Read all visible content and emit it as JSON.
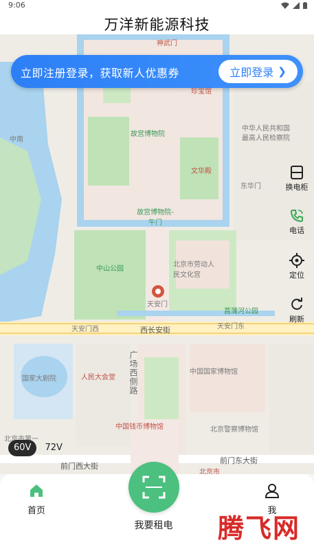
{
  "status_bar": {
    "time": "9:06"
  },
  "header": {
    "title": "万洋新能源科技"
  },
  "promo": {
    "text": "立即注册登录，获取新人优惠券",
    "button_label": "立即登录",
    "chevron": "❯",
    "color": "#2d7ff6"
  },
  "map": {
    "labels": [
      {
        "text": "神武门",
        "kind": "red"
      },
      {
        "text": "珍宝馆",
        "kind": "red"
      },
      {
        "text": "故宫博物院",
        "kind": "green"
      },
      {
        "text": "文华殿",
        "kind": "red"
      },
      {
        "text": "中华人民共和国",
        "kind": "plain"
      },
      {
        "text": "最高人民检察院",
        "kind": "plain"
      },
      {
        "text": "中南",
        "kind": "plain"
      },
      {
        "text": "东华门",
        "kind": "plain"
      },
      {
        "text": "故宫博物院-午门",
        "kind": "green"
      },
      {
        "text": "中山公园",
        "kind": "green"
      },
      {
        "text": "北京市劳动人民文化宫",
        "kind": "plain"
      },
      {
        "text": "天安门",
        "kind": "plain"
      },
      {
        "text": "菖蒲河公园",
        "kind": "green"
      },
      {
        "text": "天安门西",
        "kind": "plain"
      },
      {
        "text": "西长安街",
        "kind": "plain"
      },
      {
        "text": "天安门东",
        "kind": "plain"
      },
      {
        "text": "国家大剧院",
        "kind": "plain"
      },
      {
        "text": "人民大会堂",
        "kind": "red"
      },
      {
        "text": "广场西侧路",
        "kind": "vertical"
      },
      {
        "text": "中国国家博物馆",
        "kind": "plain"
      },
      {
        "text": "中国钱币博物馆",
        "kind": "red"
      },
      {
        "text": "北京警察博物馆",
        "kind": "plain"
      },
      {
        "text": "北京市第一",
        "kind": "plain"
      },
      {
        "text": "前门西大街",
        "kind": "plain"
      },
      {
        "text": "前门东大街",
        "kind": "plain"
      },
      {
        "text": "北京市",
        "kind": "red"
      }
    ]
  },
  "tools": {
    "battery_cabinet": {
      "label": "换电柜",
      "icon": "battery-cabinet-icon"
    },
    "phone": {
      "label": "电话",
      "icon": "phone-icon",
      "color": "#3aa857"
    },
    "locate": {
      "label": "定位",
      "icon": "locate-icon"
    },
    "refresh": {
      "label": "刷新",
      "icon": "refresh-icon"
    }
  },
  "voltage": {
    "options": [
      "60V",
      "72V"
    ],
    "selected": "60V"
  },
  "nav": {
    "home_label": "首页",
    "rent_label": "我要租电",
    "profile_label": "我",
    "active_color": "#4cc07f"
  },
  "watermark": "腾飞网"
}
